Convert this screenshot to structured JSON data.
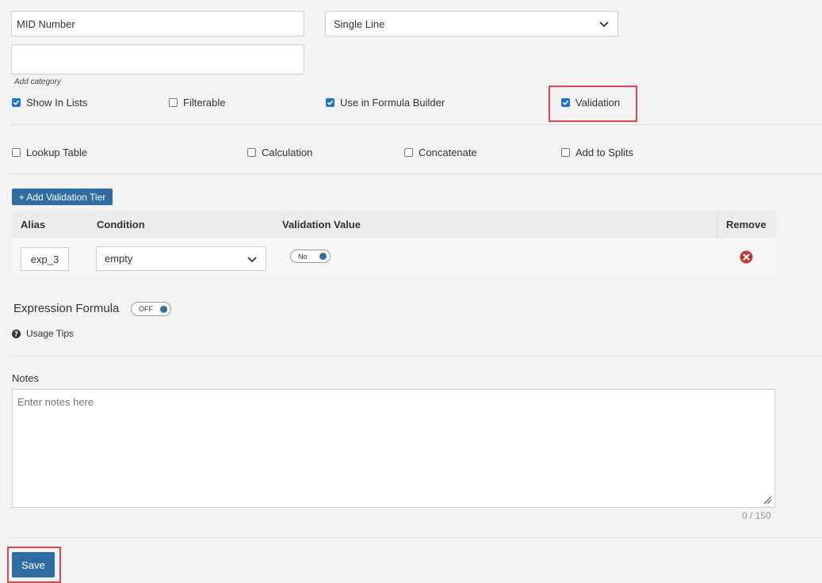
{
  "field": {
    "name_value": "MID Number",
    "type_value": "Single Line",
    "category_value": "",
    "category_hint": "Add category"
  },
  "checks_row1": [
    {
      "label": "Show In Lists",
      "checked": true
    },
    {
      "label": "Filterable",
      "checked": false
    },
    {
      "label": "Use in Formula Builder",
      "checked": true
    },
    {
      "label": "Validation",
      "checked": true
    }
  ],
  "checks_row2": [
    {
      "label": "Lookup Table",
      "checked": false
    },
    {
      "label": "Calculation",
      "checked": false
    },
    {
      "label": "Concatenate",
      "checked": false
    },
    {
      "label": "Add to Splits",
      "checked": false
    }
  ],
  "validation": {
    "add_tier_label": "+ Add Validation Tier",
    "headers": {
      "alias": "Alias",
      "condition": "Condition",
      "value": "Validation Value",
      "remove": "Remove"
    },
    "rows": [
      {
        "alias": "exp_3",
        "condition": "empty",
        "value_toggle": "No"
      }
    ]
  },
  "expression": {
    "label": "Expression Formula",
    "toggle": "OFF"
  },
  "usage_tips": "Usage Tips",
  "notes": {
    "label": "Notes",
    "placeholder": "Enter notes here",
    "counter": "0 / 150"
  },
  "save_label": "Save",
  "colors": {
    "accent": "#2e6da4",
    "checkbox": "#1e74d6",
    "remove": "#c0392b",
    "highlight": "#e0454a"
  },
  "icons": {
    "select": "chevron-down-icon",
    "remove": "times-circle-icon",
    "tips": "question-circle-icon",
    "check": "check-icon"
  }
}
